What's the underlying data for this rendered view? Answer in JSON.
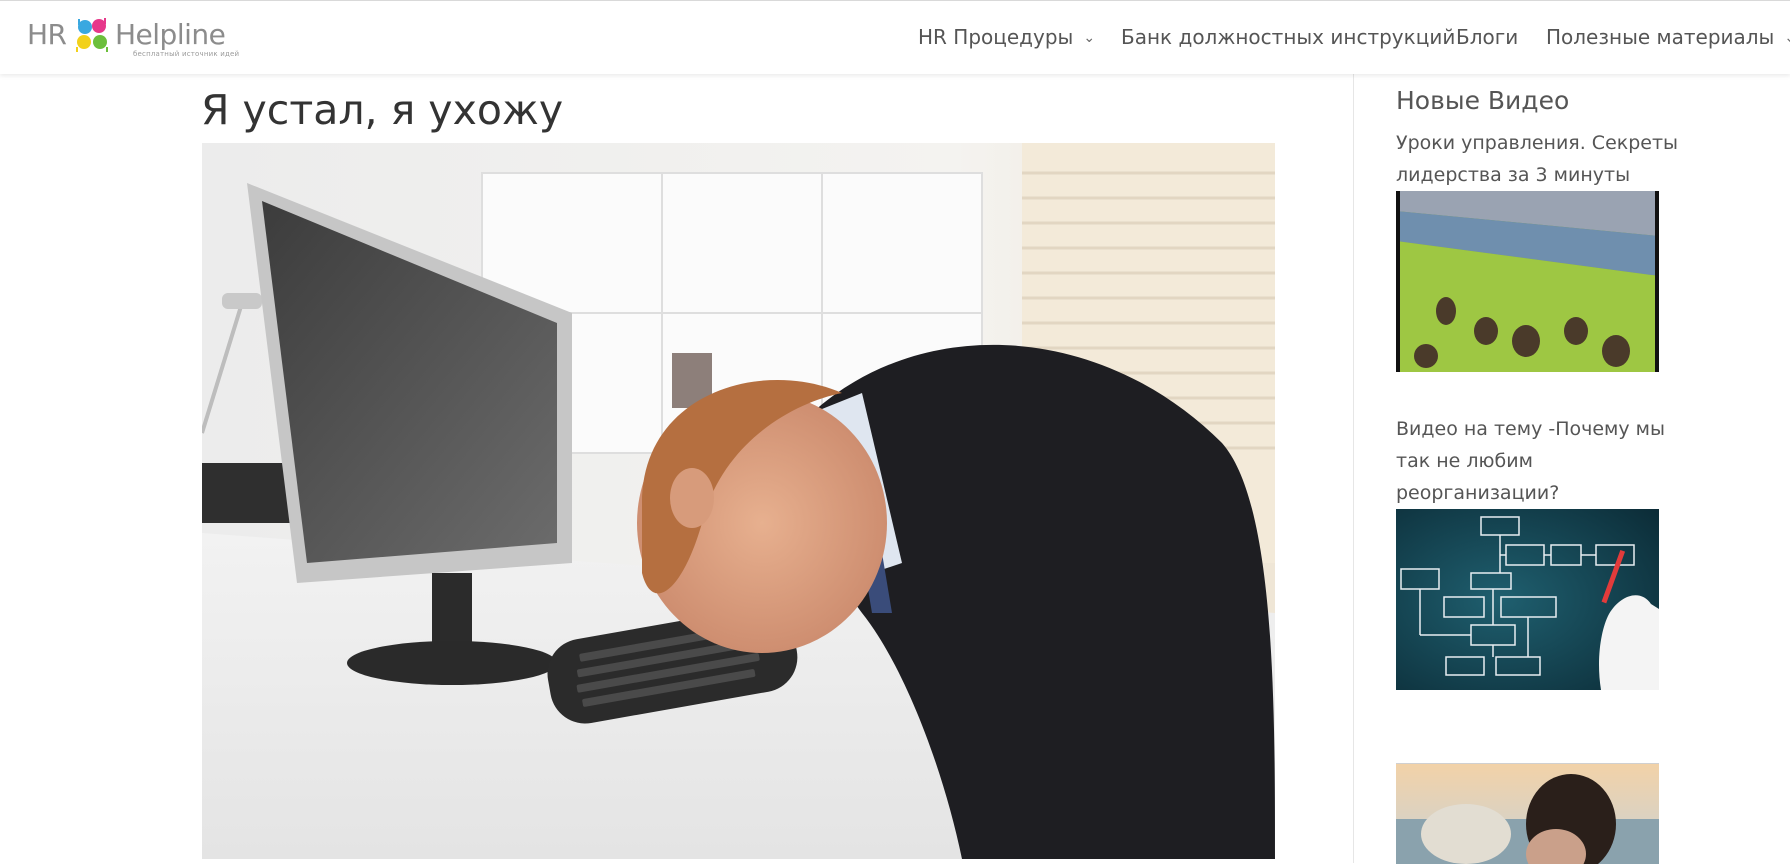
{
  "header": {
    "logo": {
      "text_hr": "HR",
      "text_helpline": "Helpline",
      "tagline": "бесплатный источник идей"
    },
    "nav": [
      {
        "label": "HR Процедуры",
        "has_dropdown": true
      },
      {
        "label": "Банк должностных инструкций",
        "has_dropdown": false
      },
      {
        "label": "Блоги",
        "has_dropdown": false
      },
      {
        "label": "Полезные материалы",
        "has_dropdown": true
      }
    ]
  },
  "post": {
    "title": "Я устал, я ухожу"
  },
  "sidebar": {
    "heading": "Новые Видео",
    "videos": [
      {
        "title": "Уроки управления. Секреты лидерства за 3 минуты"
      },
      {
        "title": "Видео на тему -Почему мы так не любим реорганизации?"
      }
    ]
  },
  "colors": {
    "nav_text": "#555555",
    "title_text": "#333333",
    "logo_gray": "#8c8c8c"
  }
}
